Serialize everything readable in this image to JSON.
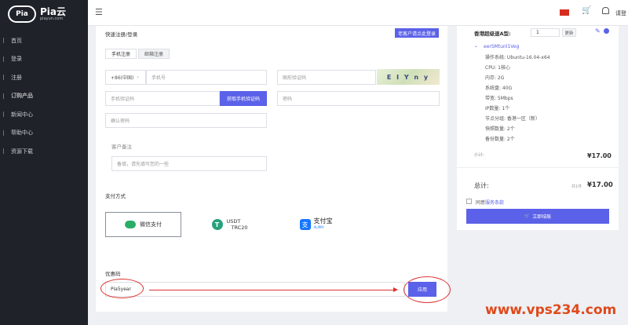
{
  "sidebar": {
    "logo_badge": "Pia",
    "logo_name": "Pia云",
    "logo_sub": "piayun.com",
    "items": [
      {
        "label": "首页"
      },
      {
        "label": "登录"
      },
      {
        "label": "注册"
      },
      {
        "label": "订购产品",
        "active": true
      },
      {
        "label": "新闻中心"
      },
      {
        "label": "帮助中心"
      },
      {
        "label": "资源下载"
      }
    ]
  },
  "topbar": {
    "user_label": "请登"
  },
  "form": {
    "section_title": "快速注册/登录",
    "existing_login_button": "老客户请点此登录",
    "tabs": [
      "手机注册",
      "邮箱注册"
    ],
    "country_code": "+86(中国)",
    "phone_placeholder": "手机号",
    "captcha_placeholder": "图形验证码",
    "captcha_text": "E I Y n y",
    "sms_code_placeholder": "手机验证码",
    "get_code_button": "获取手机验证码",
    "password_placeholder": "密码",
    "confirm_password_placeholder": "确认密码",
    "remarks_label": "客户备注",
    "remarks_placeholder": "备填，请先填写您的一些"
  },
  "payment": {
    "title": "支付方式",
    "methods": [
      {
        "label": "微信支付"
      },
      {
        "label_line1": "USDT",
        "label_line2": "TRC20"
      },
      {
        "label": "支付宝",
        "sub": "ALIPAY"
      }
    ]
  },
  "coupon": {
    "label": "优惠码",
    "value": "Pia5year",
    "apply_button": "应用"
  },
  "order": {
    "product_name": "香港超级速A型:",
    "quantity": "1",
    "update_button": "更新",
    "config_name": "eerSMtunl1Veg",
    "specs": [
      "操作系统: Ubuntu-16.04-x64",
      "CPU: 1核心",
      "内存: 2G",
      "系统盘: 40G",
      "带宽: 5Mbps",
      "IP数量: 1个",
      "节点分组: 香港一区（新）",
      "快照数量: 2个",
      "备份数量: 2个"
    ],
    "subtotal_label": "小计:",
    "subtotal_value": "¥17.00",
    "total_label": "总计:",
    "total_count": "共1件",
    "total_value": "¥17.00",
    "agree_prefix": "同意",
    "agree_link": "服务条款",
    "checkout_button": "立即结账"
  },
  "watermark": "www.vps234.com",
  "colors": {
    "accent": "#5b61e8",
    "sidebar_bg": "#1f2329",
    "watermark": "#e0491b",
    "annotation_red": "#dd3333"
  }
}
